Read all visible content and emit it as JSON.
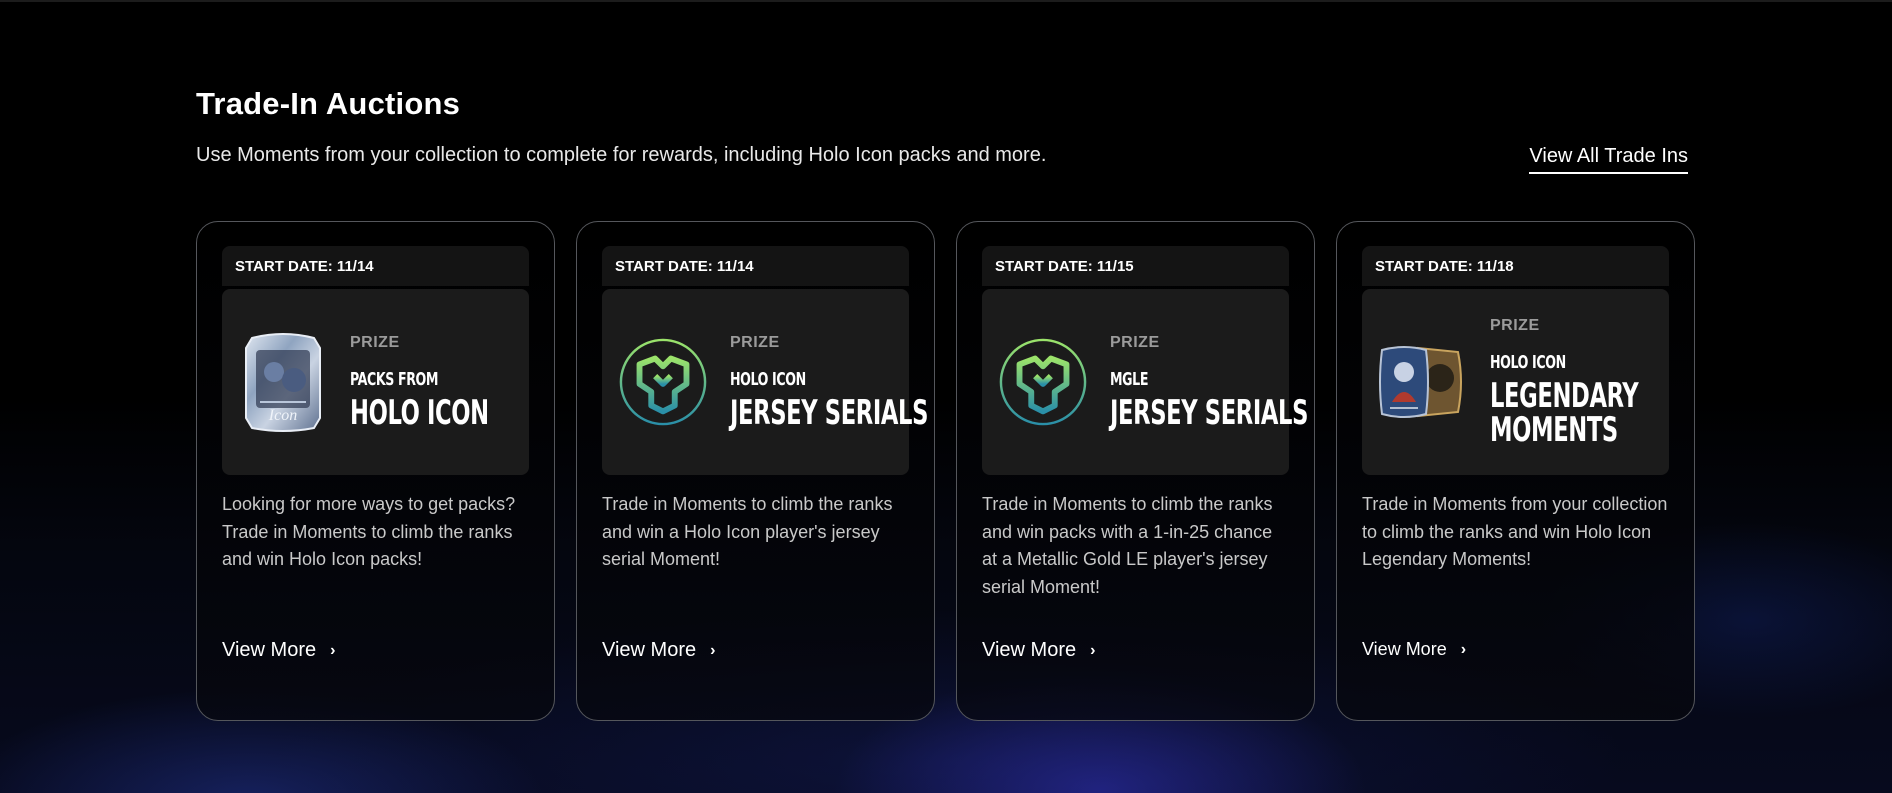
{
  "section": {
    "title": "Trade-In Auctions",
    "subtitle": "Use Moments from your collection to complete for rewards, including Holo Icon packs and more.",
    "view_all_label": "View All Trade Ins"
  },
  "cards": [
    {
      "start_date": "START DATE: 11/14",
      "prize_label": "PRIZE",
      "prize_small": "PACKS FROM",
      "prize_big": "HOLO ICON",
      "art": "holo-icon-pack",
      "description": "Looking for more ways to get packs? Trade in Moments to climb the ranks and win Holo Icon packs!",
      "cta": "View More"
    },
    {
      "start_date": "START DATE: 11/14",
      "prize_label": "PRIZE",
      "prize_small": "HOLO ICON",
      "prize_big": "JERSEY SERIALS",
      "art": "jersey-serial-badge",
      "description": "Trade in Moments to climb the ranks and win a Holo Icon player's jersey serial Moment!",
      "cta": "View More"
    },
    {
      "start_date": "START DATE: 11/15",
      "prize_label": "PRIZE",
      "prize_small": "MGLE",
      "prize_big": "JERSEY SERIALS",
      "art": "jersey-serial-badge",
      "description": "Trade in Moments to climb the ranks and win packs with a 1-in-25 chance at a Metallic Gold LE player's jersey serial Moment!",
      "cta": "View More"
    },
    {
      "start_date": "START DATE: 11/18",
      "prize_label": "PRIZE",
      "prize_small": "HOLO ICON",
      "prize_big_line1": "LEGENDARY",
      "prize_big_line2": "MOMENTS",
      "art": "legendary-moment-cards",
      "description": "Trade in Moments from your collection to climb the ranks and win Holo Icon Legendary Moments!",
      "cta": "View More"
    }
  ]
}
